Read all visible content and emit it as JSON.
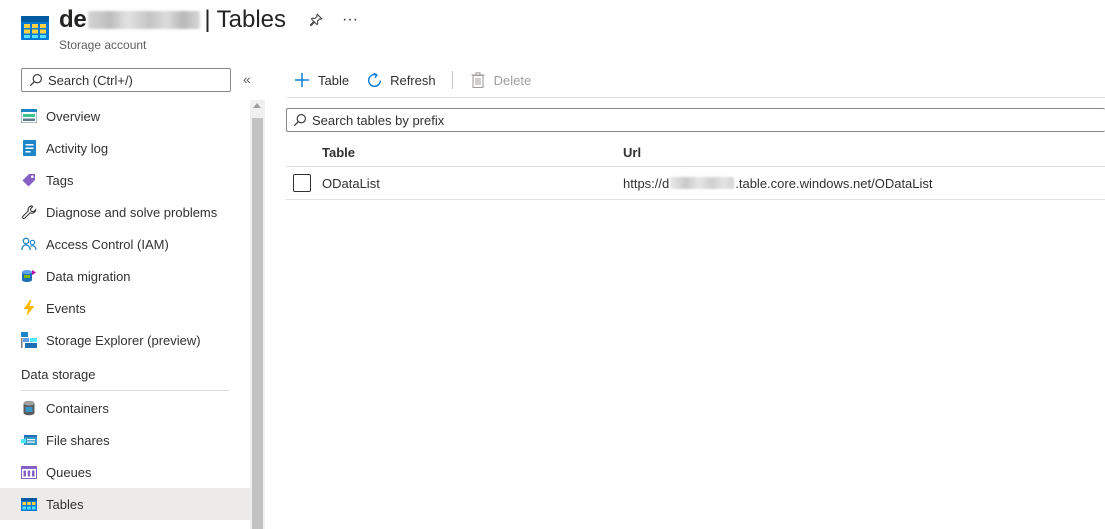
{
  "header": {
    "account_name_visible": "de",
    "separator": "|",
    "page_title": "Tables",
    "subtitle": "Storage account",
    "more_label": "···"
  },
  "sidebar": {
    "search_placeholder": "Search (Ctrl+/)",
    "collapse_label": "«",
    "items": [
      {
        "label": "Overview",
        "icon": "overview-icon"
      },
      {
        "label": "Activity log",
        "icon": "activity-log-icon"
      },
      {
        "label": "Tags",
        "icon": "tag-icon"
      },
      {
        "label": "Diagnose and solve problems",
        "icon": "wrench-icon"
      },
      {
        "label": "Access Control (IAM)",
        "icon": "people-icon"
      },
      {
        "label": "Data migration",
        "icon": "data-migration-icon"
      },
      {
        "label": "Events",
        "icon": "lightning-icon"
      },
      {
        "label": "Storage Explorer (preview)",
        "icon": "storage-explorer-icon"
      }
    ],
    "section_data_storage": "Data storage",
    "data_items": [
      {
        "label": "Containers",
        "icon": "containers-icon"
      },
      {
        "label": "File shares",
        "icon": "file-shares-icon"
      },
      {
        "label": "Queues",
        "icon": "queues-icon"
      },
      {
        "label": "Tables",
        "icon": "tables-icon",
        "active": true
      }
    ]
  },
  "toolbar": {
    "add_table_label": "Table",
    "refresh_label": "Refresh",
    "delete_label": "Delete"
  },
  "filter": {
    "placeholder": "Search tables by prefix"
  },
  "grid": {
    "columns": [
      "Table",
      "Url"
    ],
    "rows": [
      {
        "table": "ODataList",
        "url_prefix": "https://d",
        "url_suffix": ".table.core.windows.net/ODataList"
      }
    ]
  },
  "colors": {
    "accent": "#0078d4",
    "active_bg": "#edebe9",
    "border": "#8a8886"
  }
}
